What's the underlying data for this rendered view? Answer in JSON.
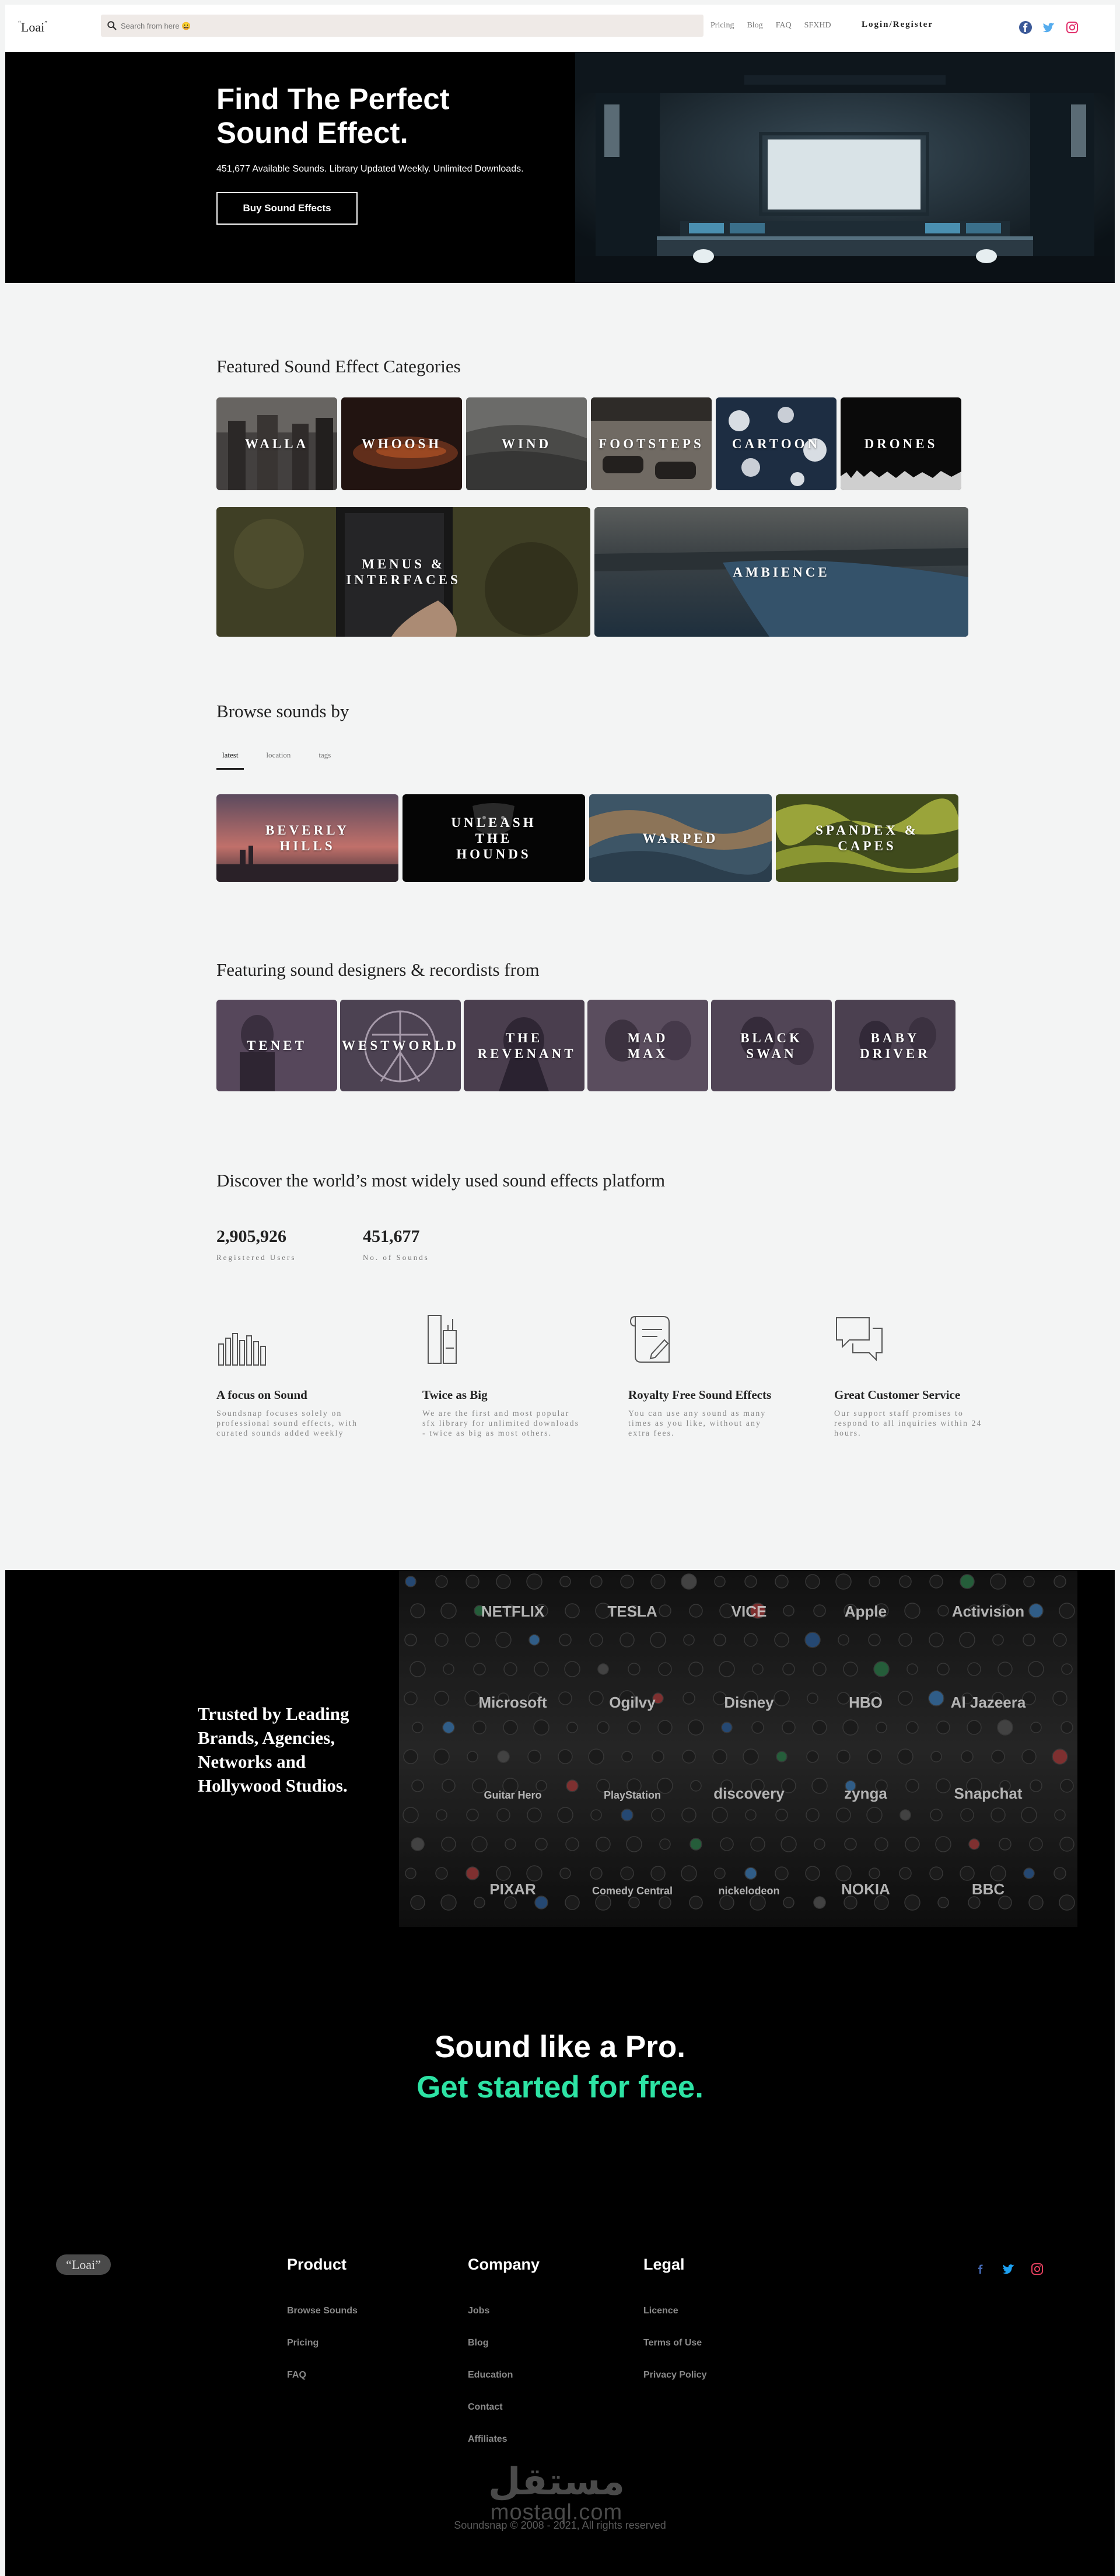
{
  "nav": {
    "logo": "Loai",
    "search_placeholder": "Search from here 😀",
    "links": [
      "Pricing",
      "Blog",
      "FAQ",
      "SFXHD"
    ],
    "login": "Login/Register",
    "social_icons": [
      "facebook-icon",
      "twitter-icon",
      "instagram-icon"
    ]
  },
  "hero": {
    "title": "Find The Perfect Sound Effect.",
    "subtitle": "451,677 Available Sounds. Library Updated Weekly. Unlimited Downloads.",
    "button": "Buy Sound Effects"
  },
  "featured": {
    "title": "Featured Sound Effect Categories",
    "row1": [
      "WALLA",
      "WHOOSH",
      "WIND",
      "FOOTSTEPS",
      "CARTOON",
      "DRONES"
    ],
    "row2": [
      "MENUS & INTERFACES",
      "AMBIENCE"
    ]
  },
  "browse": {
    "title": "Browse sounds by",
    "tabs": [
      "latest",
      "location",
      "tags"
    ],
    "active_tab": "latest",
    "tiles": [
      "BEVERLY HILLS",
      "UNLEASH THE HOUNDS",
      "WARPED",
      "SPANDEX & CAPES"
    ]
  },
  "designers": {
    "title": "Featuring sound designers & recordists from",
    "tiles": [
      "TENET",
      "WESTWORLD",
      "THE REVENANT",
      "MAD MAX",
      "BLACK SWAN",
      "BABY DRIVER"
    ]
  },
  "platform": {
    "title": "Discover the world’s most widely used sound effects platform",
    "stats": [
      {
        "value": "2,905,926",
        "label": "Registered Users"
      },
      {
        "value": "451,677",
        "label": "No. of Sounds"
      }
    ],
    "features": [
      {
        "icon": "soundwave-icon",
        "title": "A focus on Sound",
        "text": "Soundsnap focuses solely on professional sound effects, with curated sounds added weekly"
      },
      {
        "icon": "library-books-icon",
        "title": "Twice as Big",
        "text": "We are the first and most popular sfx library for unlimited downloads - twice as big as most others."
      },
      {
        "icon": "scroll-pen-icon",
        "title": "Royalty Free Sound Effects",
        "text": "You can use any sound as many times as you like, without any extra fees."
      },
      {
        "icon": "chat-bubbles-icon",
        "title": "Great Customer Service",
        "text": "Our support staff promises to respond to all inquiries within 24 hours."
      }
    ]
  },
  "trusted": {
    "title": "Trusted by Leading Brands, Agencies, Networks and Hollywood Studios.",
    "brands": [
      "NETFLIX",
      "TESLA",
      "VICE",
      "Apple",
      "Activision",
      "Microsoft",
      "Ogilvy",
      "Disney",
      "HBO",
      "Al Jazeera",
      "Guitar Hero",
      "PlayStation",
      "discovery",
      "zynga",
      "Snapchat",
      "PIXAR",
      "Comedy Central",
      "nickelodeon",
      "NOKIA",
      "BBC"
    ]
  },
  "cta": {
    "line1": "Sound like a Pro.",
    "line2": "Get started for free.",
    "accent": "#2de3a4"
  },
  "footer": {
    "logo": "Loai",
    "columns": [
      {
        "title": "Product",
        "links": [
          "Browse Sounds",
          "Pricing",
          "FAQ"
        ]
      },
      {
        "title": "Company",
        "links": [
          "Jobs",
          "Blog",
          "Education",
          "Contact",
          "Affiliates"
        ]
      },
      {
        "title": "Legal",
        "links": [
          "Licence",
          "Terms of Use",
          "Privacy Policy"
        ]
      }
    ],
    "social_icons": [
      "facebook-icon",
      "twitter-icon",
      "instagram-icon"
    ],
    "copyright": "Soundsnap © 2008 - 2021, All rights reserved",
    "watermark_ar": "مستقل",
    "watermark_en": "mostaql.com"
  }
}
